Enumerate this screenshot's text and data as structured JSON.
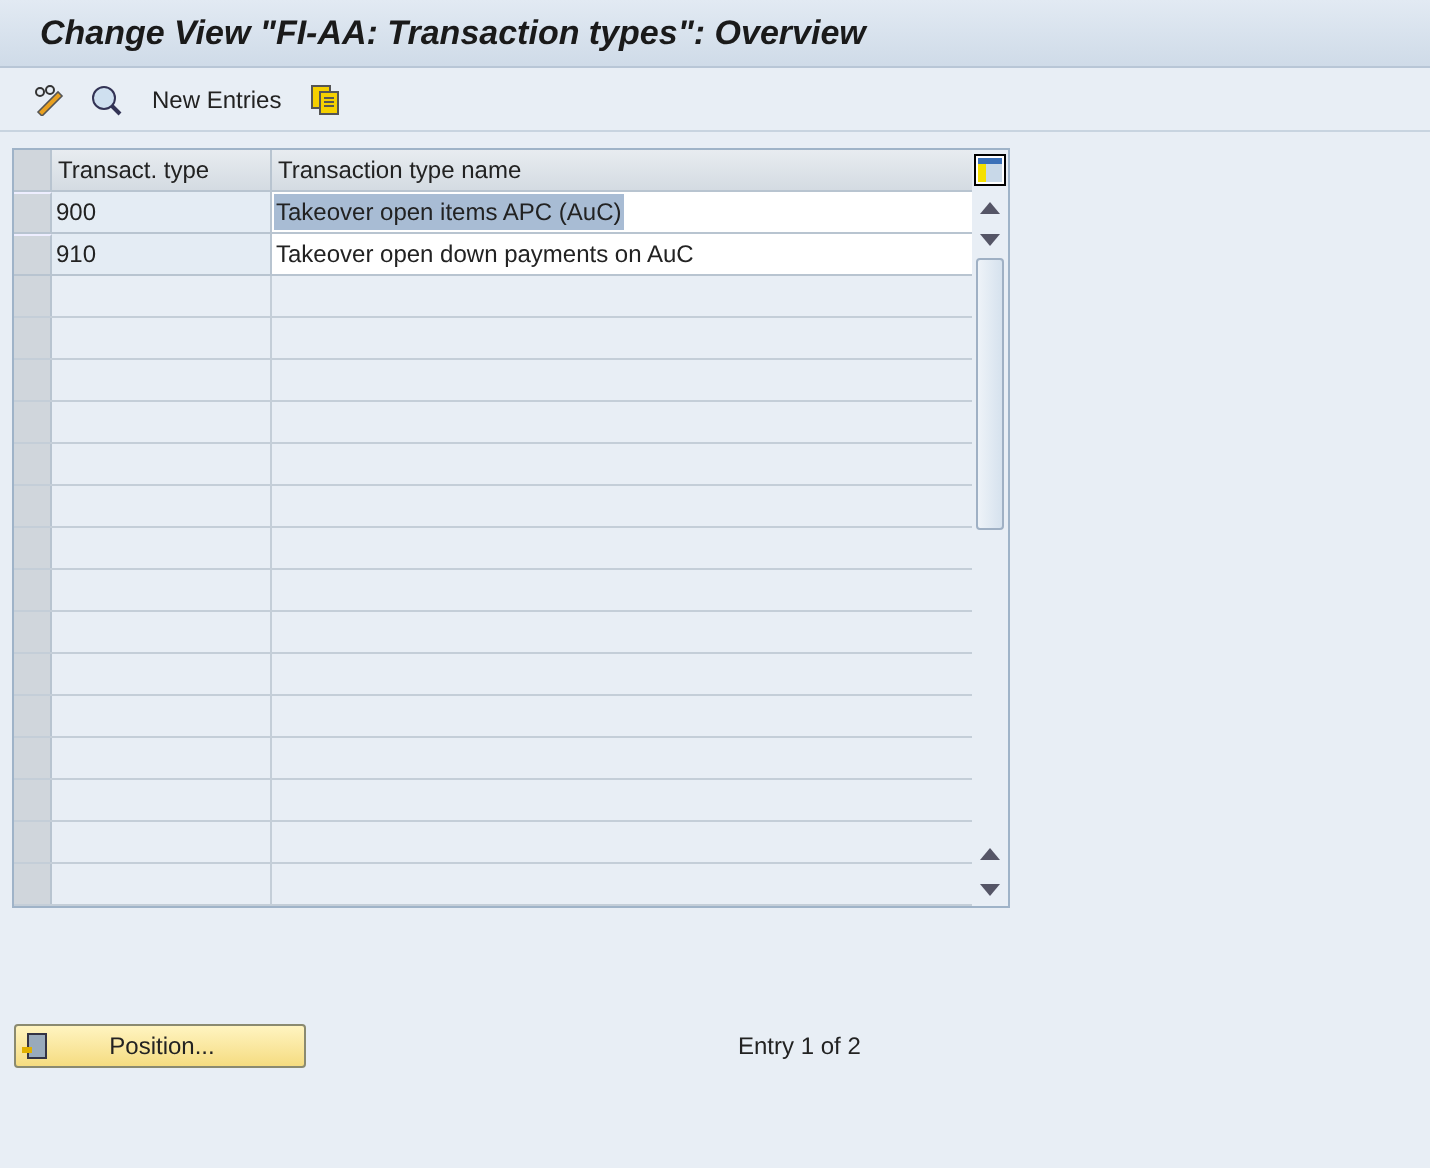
{
  "window": {
    "title": "Change View \"FI-AA: Transaction types\": Overview"
  },
  "toolbar": {
    "items": [
      {
        "kind": "edit"
      },
      {
        "kind": "details"
      },
      {
        "kind": "text",
        "label": "New Entries"
      },
      {
        "kind": "copy"
      }
    ]
  },
  "table": {
    "columns": [
      "Transact. type",
      "Transaction type name"
    ],
    "rows": [
      {
        "type": "900",
        "name": "Takeover open items APC (AuC)",
        "highlighted": true
      },
      {
        "type": "910",
        "name": "Takeover open down payments on AuC",
        "highlighted": false
      }
    ]
  },
  "footer": {
    "button": "Position...",
    "entry_info": "Entry 1 of 2"
  }
}
